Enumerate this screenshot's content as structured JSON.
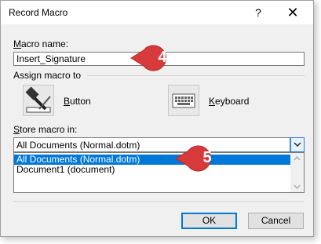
{
  "dialog": {
    "title": "Record Macro",
    "help_label": "?",
    "close_label": "✕"
  },
  "macro_name": {
    "label_prefix": "",
    "label_mnemonic": "M",
    "label_rest": "acro name:",
    "value": "Insert_Signature"
  },
  "assign": {
    "title": "Assign macro to",
    "button_label_mnemonic": "B",
    "button_label_rest": "utton",
    "keyboard_label_mnemonic": "K",
    "keyboard_label_rest": "eyboard"
  },
  "store": {
    "label_prefix": "",
    "label_mnemonic": "S",
    "label_rest": "tore macro in:",
    "selected": "All Documents (Normal.dotm)",
    "options": [
      "All Documents (Normal.dotm)",
      "Document1 (document)"
    ]
  },
  "buttons": {
    "ok": "OK",
    "cancel": "Cancel"
  },
  "callouts": {
    "first": "4",
    "second": "5"
  },
  "colors": {
    "callout_red": "#d63a3a",
    "selection_blue": "#0078d7"
  }
}
